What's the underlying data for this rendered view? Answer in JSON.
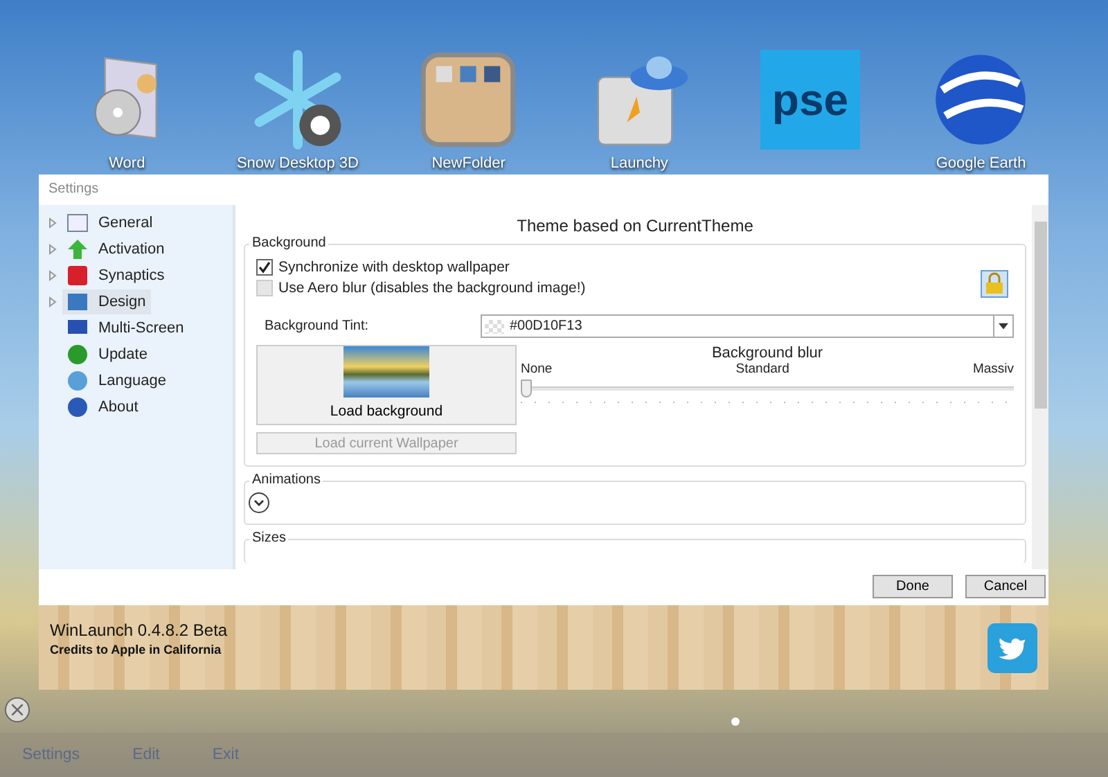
{
  "apps": [
    {
      "label": "Word"
    },
    {
      "label": "Snow Desktop 3D"
    },
    {
      "label": "NewFolder"
    },
    {
      "label": "Launchy"
    },
    {
      "label": "pse"
    },
    {
      "label": "Google Earth"
    }
  ],
  "dialog": {
    "title": "Settings",
    "nav": [
      {
        "label": "General",
        "expandable": true,
        "selected": false
      },
      {
        "label": "Activation",
        "expandable": true,
        "selected": false
      },
      {
        "label": "Synaptics",
        "expandable": true,
        "selected": false
      },
      {
        "label": "Design",
        "expandable": true,
        "selected": true
      },
      {
        "label": "Multi-Screen",
        "expandable": false,
        "selected": false
      },
      {
        "label": "Update",
        "expandable": false,
        "selected": false
      },
      {
        "label": "Language",
        "expandable": false,
        "selected": false
      },
      {
        "label": "About",
        "expandable": false,
        "selected": false
      }
    ],
    "heading": "Theme based on CurrentTheme",
    "background": {
      "title": "Background",
      "options": [
        {
          "label": "Synchronize with desktop wallpaper",
          "checked": true,
          "disabled": false
        },
        {
          "label": "Use Aero blur (disables the background image!)",
          "checked": false,
          "disabled": true
        }
      ],
      "tint_label": "Background Tint:",
      "tint_value": "#00D10F13",
      "load_background": "Load background",
      "load_wallpaper": {
        "label": "Load current Wallpaper",
        "disabled": true
      },
      "blur": {
        "title": "Background blur",
        "ticks": [
          "None",
          "Standard",
          "Massiv"
        ],
        "level": 0
      }
    },
    "sections": [
      {
        "title": "Animations",
        "expanded": false
      },
      {
        "title": "Sizes"
      }
    ],
    "buttons": [
      "Done",
      "Cancel"
    ]
  },
  "footer": {
    "title": "WinLaunch 0.4.8.2 Beta",
    "credits": "Credits to Apple in California"
  },
  "menu": [
    "Settings",
    "Edit",
    "Exit"
  ]
}
